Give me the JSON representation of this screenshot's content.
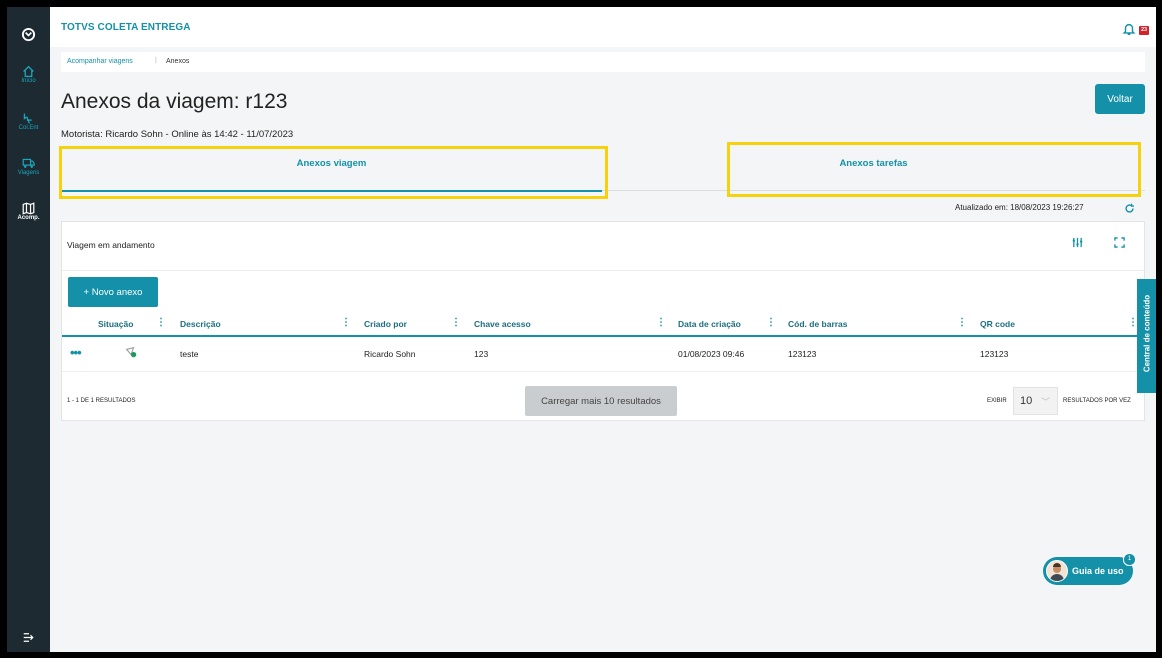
{
  "app": {
    "title": "TOTVS COLETA ENTREGA",
    "notification_count": "23"
  },
  "colors": {
    "primary": "#1491a8",
    "sidebar": "#1d2a31",
    "highlight": "#f5d20d",
    "notification": "#d1232a"
  },
  "sidebar": {
    "items": [
      {
        "icon": "home-icon",
        "label": "Início"
      },
      {
        "icon": "package-icon",
        "label": "Col.Ent"
      },
      {
        "icon": "truck-icon",
        "label": "Viagens"
      },
      {
        "icon": "map-icon",
        "label": "Acomp."
      }
    ]
  },
  "breadcrumb": {
    "parent": "Acompanhar viagens",
    "current": "Anexos"
  },
  "page": {
    "title": "Anexos da viagem: r123",
    "back_label": "Voltar",
    "driver": "Motorista: Ricardo Sohn - Online às 14:42 - 11/07/2023"
  },
  "tabs": [
    {
      "label": "Anexos viagem",
      "active": true
    },
    {
      "label": "Anexos tarefas",
      "active": false
    }
  ],
  "updated": "Atualizado em: 18/08/2023 19:26:27",
  "card": {
    "title": "Viagem em andamento",
    "new_button": "+ Novo anexo",
    "columns": [
      "Situação",
      "Descrição",
      "Criado por",
      "Chave acesso",
      "Data de criação",
      "Cód. de barras",
      "QR code"
    ],
    "rows": [
      {
        "descricao": "teste",
        "criado_por": "Ricardo Sohn",
        "chave": "123",
        "data": "01/08/2023 09:46",
        "barras": "123123",
        "qr": "123123"
      }
    ],
    "results_text": "1 - 1 DE 1 RESULTADOS",
    "load_more": "Carregar mais 10 resultados",
    "show_label": "EXIBIR",
    "page_size": "10",
    "per_page_label": "RESULTADOS POR VEZ"
  },
  "side_panel": "Central de conteúdo",
  "guide": {
    "label": "Guia de uso",
    "badge": "1"
  }
}
